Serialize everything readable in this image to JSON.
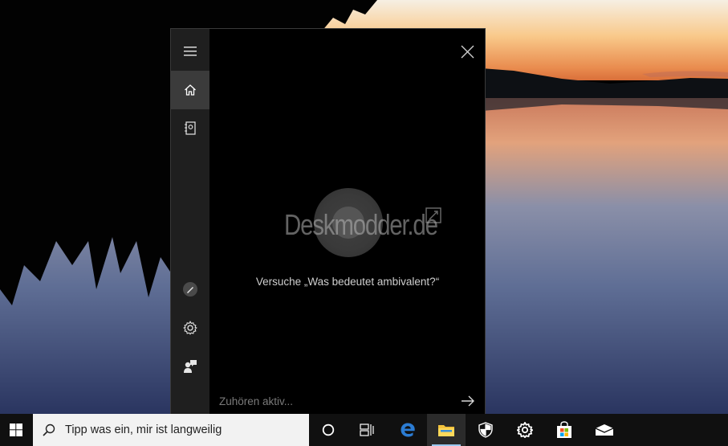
{
  "cortana": {
    "prompt": "Versuche „Was bedeutet ambivalent?“",
    "input_placeholder": "Zuhören aktiv...",
    "watermark": "Deskmodder.de",
    "nav": [
      "menu-icon",
      "home-icon",
      "notebook-icon",
      "pen-icon",
      "gear-icon",
      "feedback-icon"
    ],
    "active_nav": "home"
  },
  "taskbar": {
    "search_text": "Tipp was ein, mir ist langweilig",
    "apps": [
      "cortana-circle-icon",
      "task-view-icon",
      "edge-icon",
      "file-explorer-icon",
      "windows-security-icon",
      "settings-icon",
      "store-icon",
      "mail-icon"
    ],
    "active_app": "file-explorer"
  },
  "colors": {
    "rail_bg": "#1f1f1f",
    "taskbar_bg": "#101010",
    "edge_blue": "#2b7cd3",
    "explorer_yellow": "#f3c23c"
  }
}
